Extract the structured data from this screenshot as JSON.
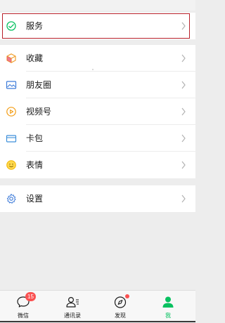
{
  "menu": {
    "service": {
      "label": "服务",
      "icon": "service-icon"
    },
    "favorites": {
      "label": "收藏",
      "icon": "favorites-cube-icon"
    },
    "moments": {
      "label": "朋友圈",
      "icon": "moments-photo-icon"
    },
    "channels": {
      "label": "视频号",
      "icon": "channels-play-icon"
    },
    "cards": {
      "label": "卡包",
      "icon": "card-wallet-icon"
    },
    "stickers": {
      "label": "表情",
      "icon": "sticker-smiley-icon"
    },
    "settings": {
      "label": "设置",
      "icon": "settings-gear-icon"
    }
  },
  "tabbar": {
    "chats": {
      "label": "微信",
      "badge": "15",
      "icon": "chat-bubble-icon"
    },
    "contacts": {
      "label": "通讯录",
      "icon": "contacts-icon"
    },
    "discover": {
      "label": "发现",
      "icon": "compass-icon"
    },
    "me": {
      "label": "我",
      "icon": "person-icon"
    }
  },
  "colors": {
    "accent_green": "#07c160",
    "badge_red": "#fa5151",
    "highlight_border": "#b8202a",
    "background": "#ededed"
  }
}
